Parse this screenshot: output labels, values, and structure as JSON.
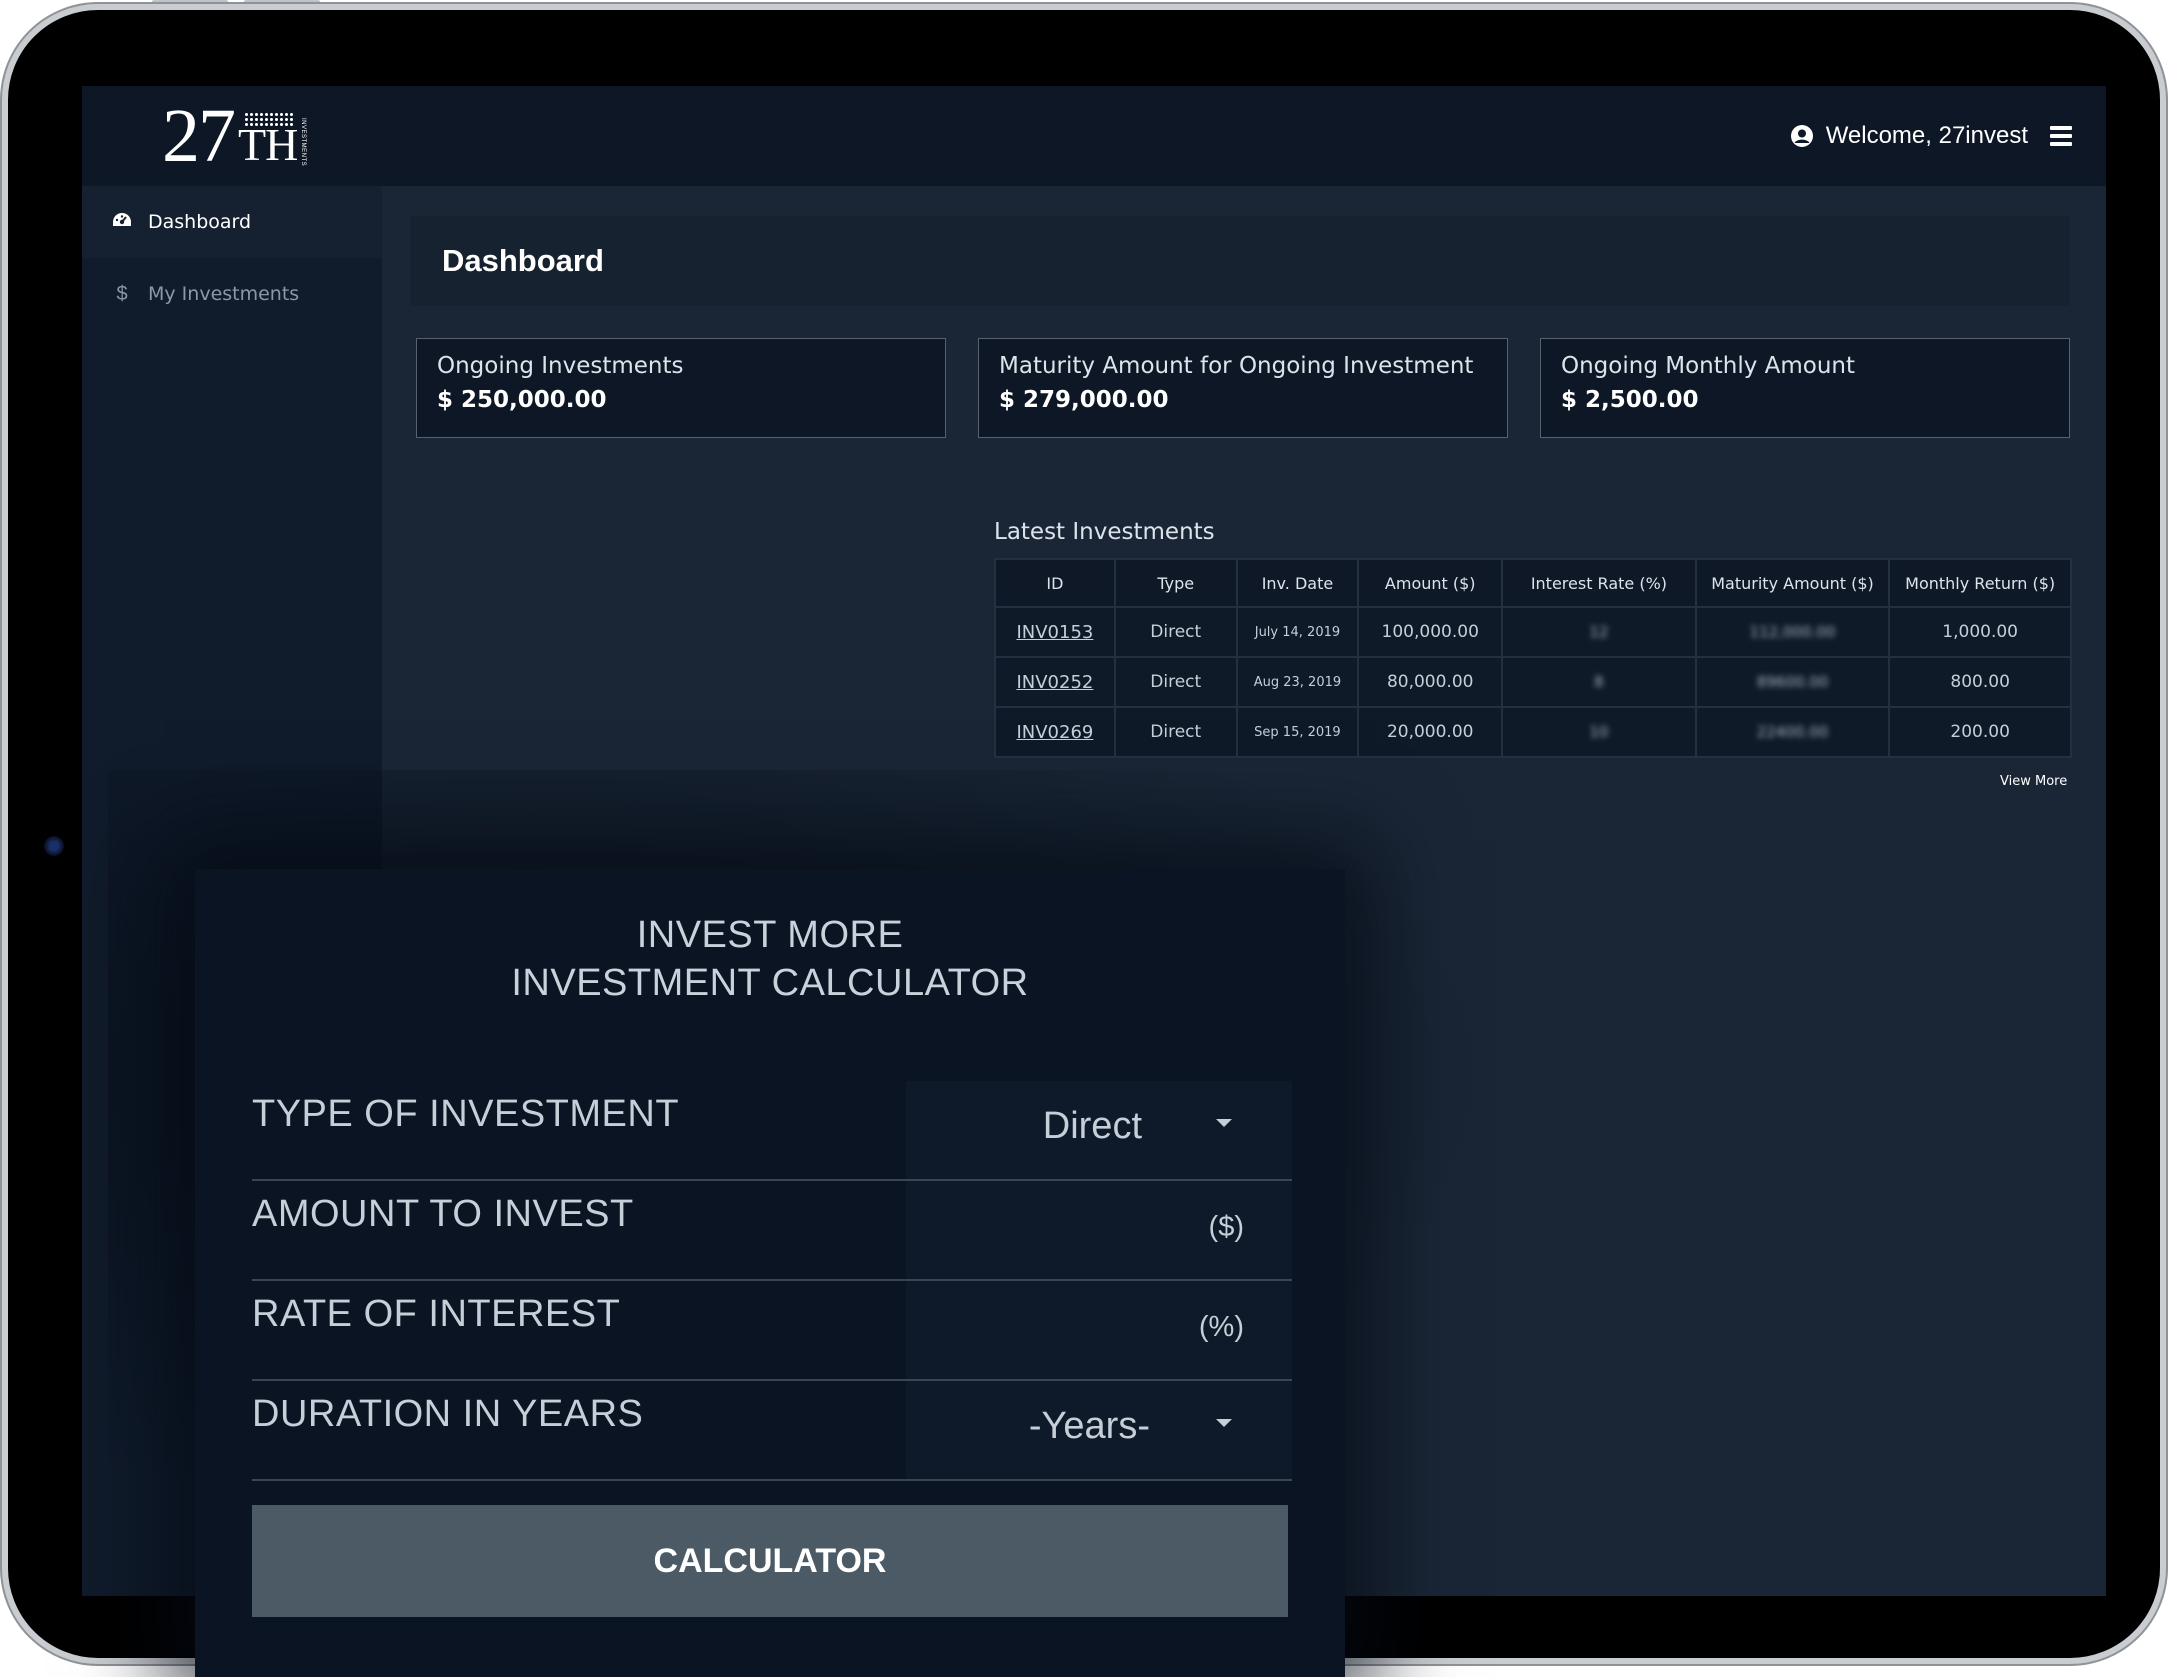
{
  "brand": {
    "logo_number": "27",
    "logo_suffix": "TH",
    "logo_subtext": "INVESTMENTS"
  },
  "header": {
    "welcome_text": "Welcome, 27invest",
    "user_icon": "user-circle-icon",
    "menu_icon": "hamburger-icon"
  },
  "sidebar": {
    "items": [
      {
        "label": "Dashboard",
        "icon": "tachometer-icon",
        "active": true
      },
      {
        "label": "My Investments",
        "icon": "dollar-icon",
        "active": false
      }
    ]
  },
  "main": {
    "page_title": "Dashboard",
    "stats": [
      {
        "label": "Ongoing Investments",
        "value": "$ 250,000.00"
      },
      {
        "label": "Maturity Amount for Ongoing Investment",
        "value": "$ 279,000.00"
      },
      {
        "label": "Ongoing Monthly Amount",
        "value": "$ 2,500.00"
      }
    ],
    "latest_title": "Latest Investments",
    "table": {
      "columns": [
        "ID",
        "Type",
        "Inv. Date",
        "Amount ($)",
        "Interest Rate (%)",
        "Maturity Amount ($)",
        "Monthly Return ($)"
      ],
      "rows": [
        [
          "INV0153",
          "Direct",
          "July 14, 2019",
          "100,000.00",
          "12",
          "112,000.00",
          "1,000.00"
        ],
        [
          "INV0252",
          "Direct",
          "Aug 23, 2019",
          "80,000.00",
          "8",
          "89600.00",
          "800.00"
        ],
        [
          "INV0269",
          "Direct",
          "Sep 15, 2019",
          "20,000.00",
          "10",
          "22400.00",
          "200.00"
        ]
      ]
    },
    "view_more": "View More"
  },
  "calculator": {
    "title_line1": "INVEST MORE",
    "title_line2": "INVESTMENT CALCULATOR",
    "fields": [
      {
        "label": "TYPE OF INVESTMENT",
        "value": "Direct",
        "kind": "select"
      },
      {
        "label": "AMOUNT TO INVEST",
        "value": "",
        "unit": "($)",
        "kind": "input"
      },
      {
        "label": "RATE OF INTEREST",
        "value": "",
        "unit": "(%)",
        "kind": "input"
      },
      {
        "label": "DURATION IN YEARS",
        "value": "-Years-",
        "kind": "select"
      }
    ],
    "button_label": "CALCULATOR"
  },
  "colors": {
    "background": "#1a2636",
    "topbar": "#0d1726",
    "sidebar": "#101b2b",
    "button": "#4b5a64"
  }
}
